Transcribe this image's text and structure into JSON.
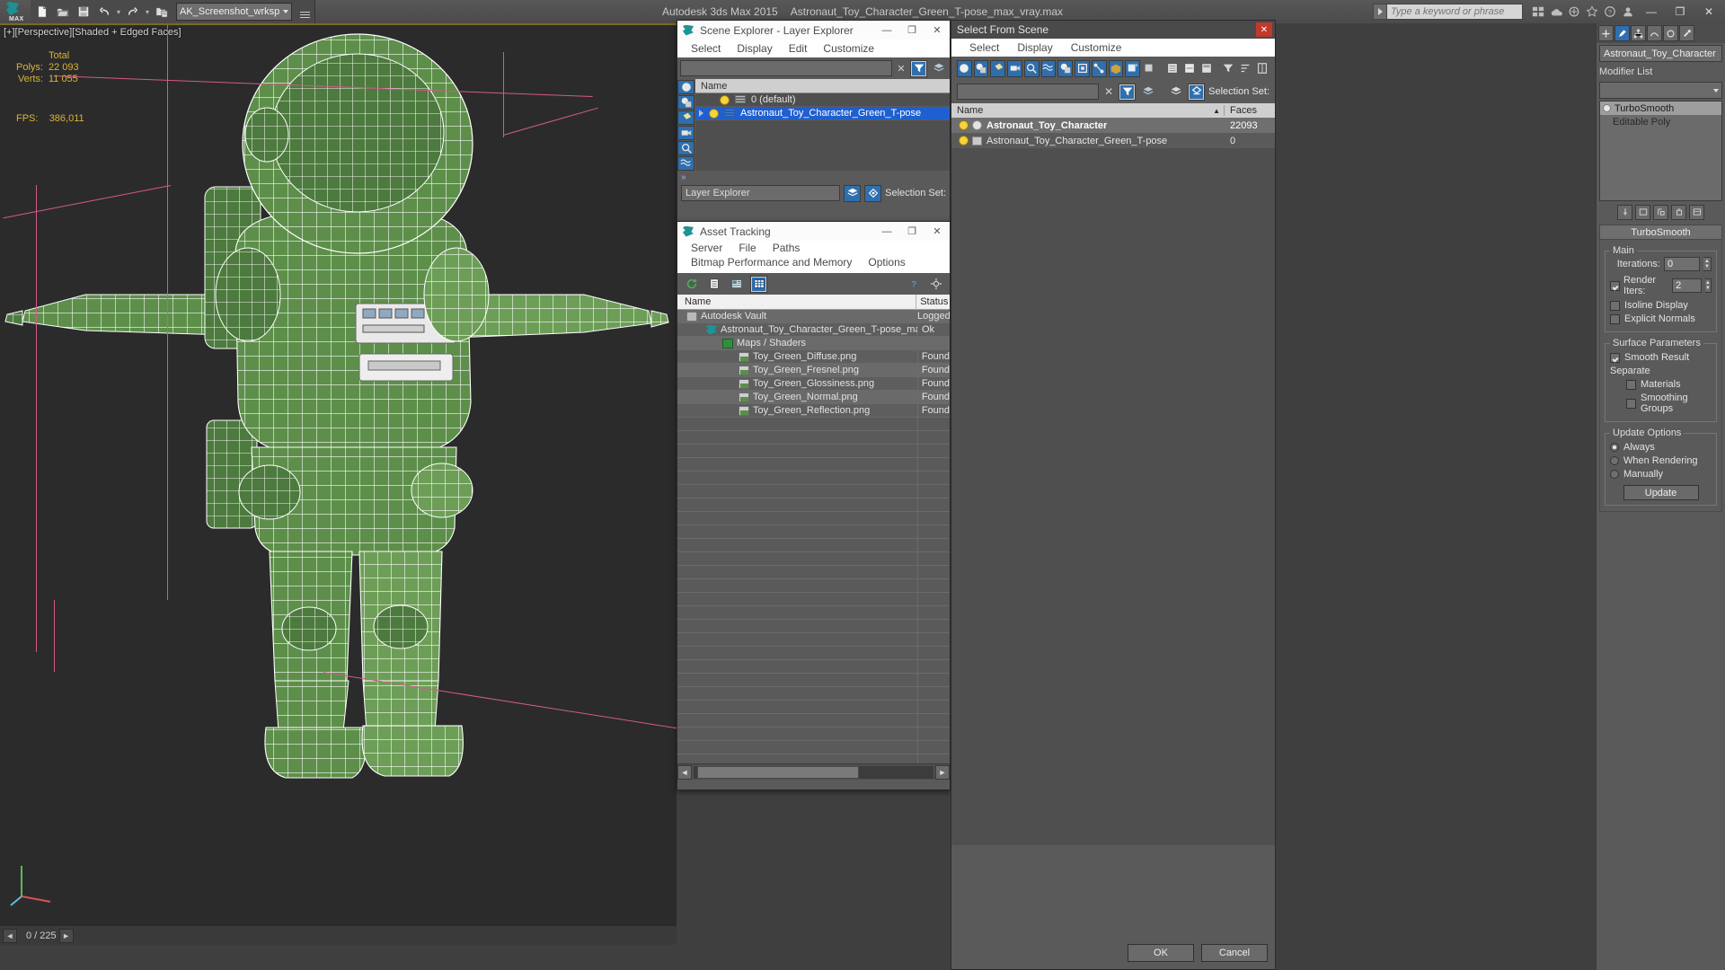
{
  "app": {
    "title": "Autodesk 3ds Max  2015",
    "document": "Astronaut_Toy_Character_Green_T-pose_max_vray.max",
    "workspace": "AK_Screenshot_wrksp",
    "search_placeholder": "Type a keyword or phrase"
  },
  "quick_access": {
    "new": "New Scene",
    "open": "Open File",
    "save": "Save File",
    "undo": "Undo",
    "redo": "Redo",
    "project": "Set Project Folder"
  },
  "window_controls": {
    "minimize": "—",
    "maximize": "❐",
    "close": "✕"
  },
  "viewport": {
    "label": "[+][Perspective][Shaded + Edged Faces]",
    "stats": {
      "header": "Total",
      "rows": [
        {
          "label": "Polys:",
          "value": "22 093"
        },
        {
          "label": "Verts:",
          "value": "11 055"
        }
      ],
      "fps_label": "FPS:",
      "fps_value": "386,011"
    },
    "timebar": {
      "frame": "0 / 225",
      "prev": "◄",
      "next": "►"
    }
  },
  "scene_explorer": {
    "title": "Scene Explorer - Layer Explorer",
    "menus": [
      "Select",
      "Display",
      "Edit",
      "Customize"
    ],
    "search_value": "",
    "column_header": "Name",
    "rows": [
      {
        "name": "0 (default)",
        "selected": false,
        "expandable": false,
        "layer_color": "grey"
      },
      {
        "name": "Astronaut_Toy_Character_Green_T-pose",
        "selected": true,
        "expandable": true,
        "layer_color": "blue"
      }
    ],
    "footer": {
      "explorer_name": "Layer Explorer",
      "selection_set_label": "Selection Set:"
    },
    "icons": [
      "sphere-filter-icon",
      "shape-filter-icon",
      "light-filter-icon",
      "camera-filter-icon",
      "helper-filter-icon",
      "spacewarp-filter-icon"
    ]
  },
  "asset_tracking": {
    "title": "Asset Tracking",
    "menus": [
      "Server",
      "File",
      "Paths",
      "Bitmap Performance and Memory",
      "Options"
    ],
    "toolbar_icons": [
      "refresh-icon",
      "list-view-icon",
      "detail-view-icon",
      "grid-view-icon",
      "help-icon",
      "settings-icon"
    ],
    "columns": [
      "Name",
      "Status"
    ],
    "rows": [
      {
        "name": "Autodesk Vault",
        "status": "Logged",
        "indent": 0,
        "icon": "vault-icon"
      },
      {
        "name": "Astronaut_Toy_Character_Green_T-pose_max_vr...",
        "status": "Ok",
        "indent": 1,
        "icon": "max-file-icon"
      },
      {
        "name": "Maps / Shaders",
        "status": "",
        "indent": 2,
        "icon": "maps-icon"
      },
      {
        "name": "Toy_Green_Diffuse.png",
        "status": "Found",
        "indent": 3,
        "icon": "bitmap-icon"
      },
      {
        "name": "Toy_Green_Fresnel.png",
        "status": "Found",
        "indent": 3,
        "icon": "bitmap-icon"
      },
      {
        "name": "Toy_Green_Glossiness.png",
        "status": "Found",
        "indent": 3,
        "icon": "bitmap-icon"
      },
      {
        "name": "Toy_Green_Normal.png",
        "status": "Found",
        "indent": 3,
        "icon": "bitmap-icon"
      },
      {
        "name": "Toy_Green_Reflection.png",
        "status": "Found",
        "indent": 3,
        "icon": "bitmap-icon"
      }
    ]
  },
  "select_from_scene": {
    "title": "Select From Scene",
    "menus": [
      "Select",
      "Display",
      "Customize"
    ],
    "search_value": "",
    "selection_set_label": "Selection Set:",
    "columns": [
      "Name",
      "Faces"
    ],
    "rows": [
      {
        "name": "Astronaut_Toy_Character",
        "faces": "22093",
        "highlighted": true
      },
      {
        "name": "Astronaut_Toy_Character_Green_T-pose",
        "faces": "0",
        "highlighted": false
      }
    ],
    "buttons": {
      "ok": "OK",
      "cancel": "Cancel"
    }
  },
  "command_panel": {
    "object_name": "Astronaut_Toy_Character",
    "modifier_list_label": "Modifier List",
    "modifier_stack": [
      {
        "name": "TurboSmooth",
        "enabled": true
      },
      {
        "name": "Editable Poly",
        "enabled": false
      }
    ],
    "rollout": {
      "title": "TurboSmooth",
      "main_group": "Main",
      "iterations_label": "Iterations:",
      "iterations_value": "0",
      "render_iters_label": "Render Iters:",
      "render_iters_value": "2",
      "render_iters_checked": true,
      "isoline_display_label": "Isoline Display",
      "isoline_display_checked": false,
      "explicit_normals_label": "Explicit Normals",
      "explicit_normals_checked": false,
      "surface_group": "Surface Parameters",
      "smooth_result_label": "Smooth Result",
      "smooth_result_checked": true,
      "separate_label": "Separate",
      "materials_label": "Materials",
      "materials_checked": false,
      "smoothing_groups_label": "Smoothing Groups",
      "smoothing_groups_checked": false,
      "update_group": "Update Options",
      "update_always": "Always",
      "update_when_rendering": "When Rendering",
      "update_manually": "Manually",
      "update_selected": "Always",
      "update_button": "Update"
    }
  },
  "colors": {
    "accent_blue": "#2f6fae",
    "selection_blue": "#1f5fd0",
    "stats_yellow": "#d9b436",
    "grid_pink": "#d45a8d",
    "model_green": "#5a8f4a",
    "close_red": "#c0392b"
  }
}
